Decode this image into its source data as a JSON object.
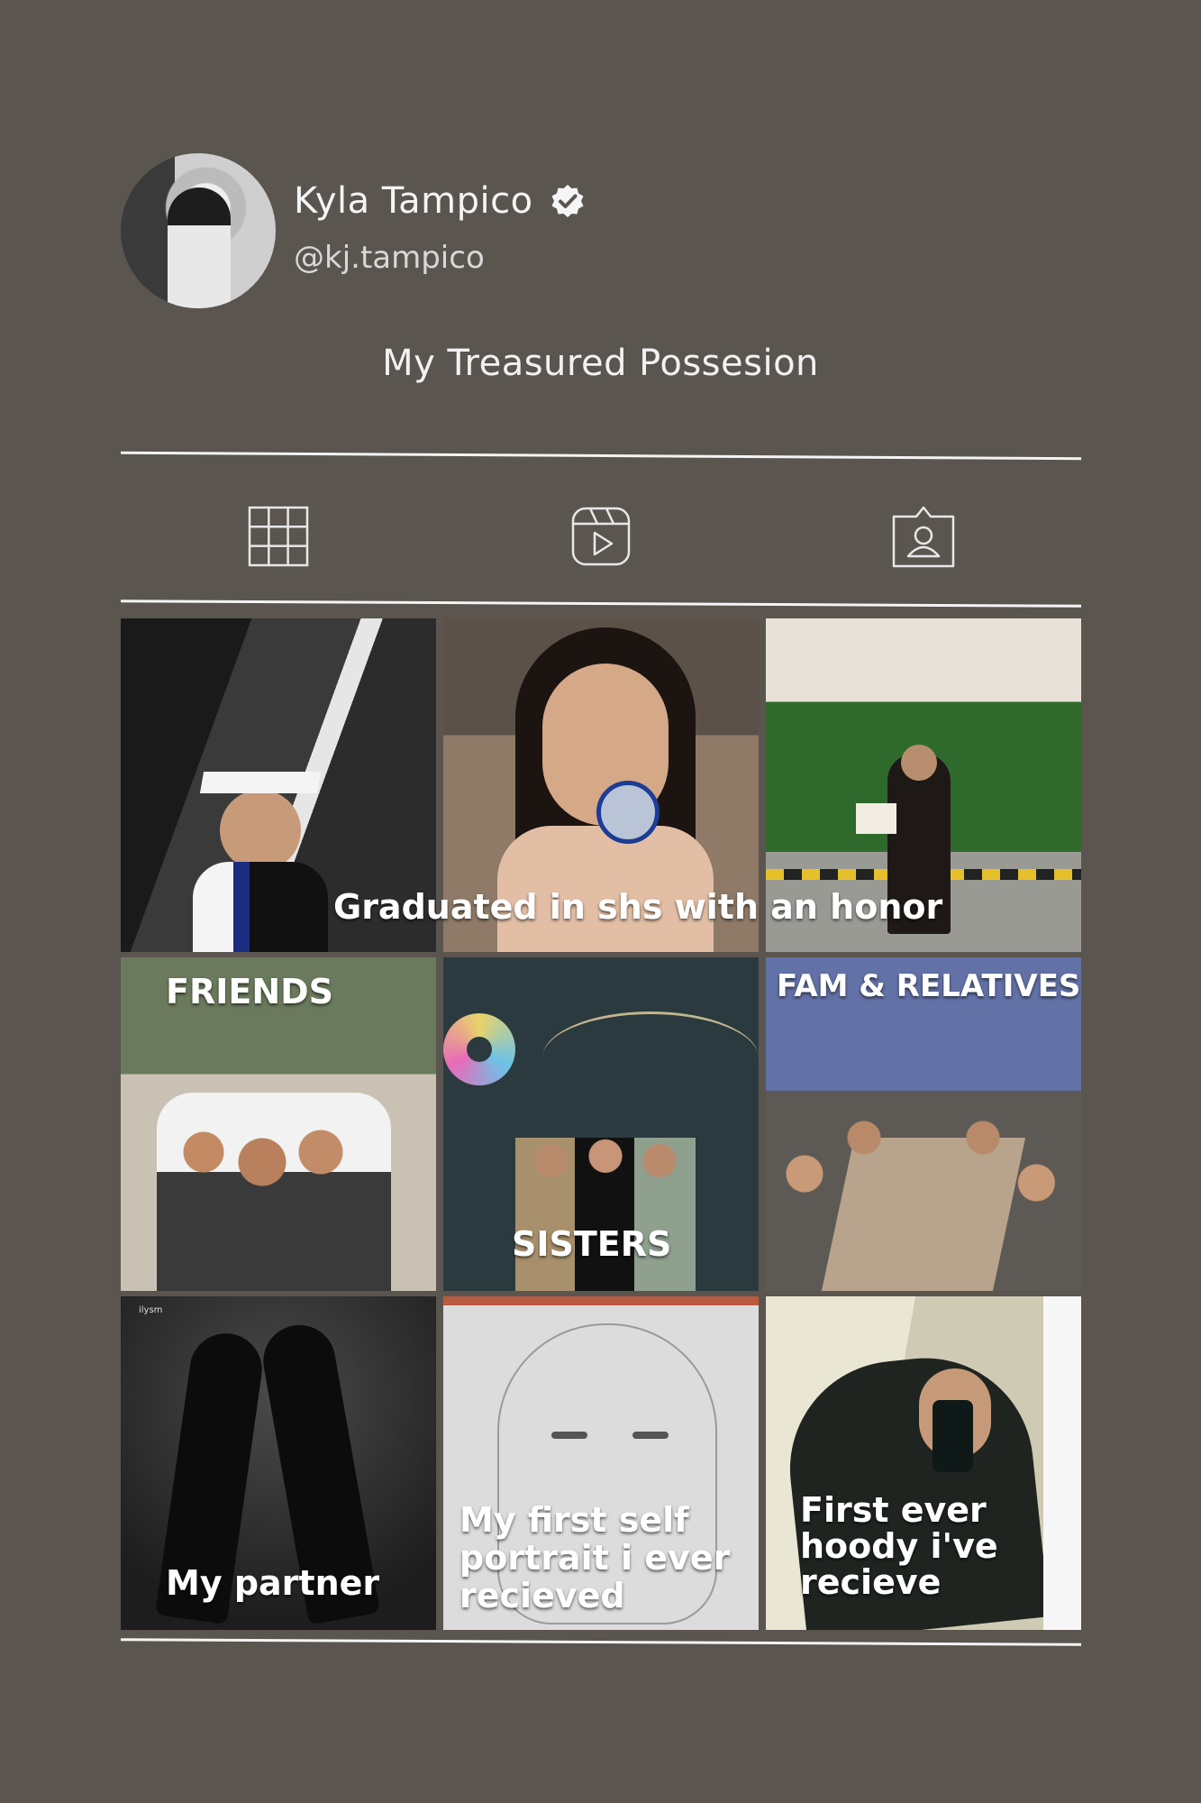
{
  "profile": {
    "name": "Kyla Tampico",
    "handle": "@kj.tampico",
    "bio": "My Treasured Possesion"
  },
  "tabs": [
    {
      "name": "grid-icon"
    },
    {
      "name": "reels-icon"
    },
    {
      "name": "tagged-icon"
    }
  ],
  "posts": [
    {
      "label": "",
      "scene": "graduation-studio"
    },
    {
      "label": "",
      "scene": "medal-selfie"
    },
    {
      "label": "",
      "scene": "graduation-garden"
    },
    {
      "label": "FRIENDS",
      "scene": "friends-selfie"
    },
    {
      "label": "SISTERS",
      "scene": "art-wall"
    },
    {
      "label": "FAM & RELATIVES",
      "scene": "family-dinner"
    },
    {
      "label": "My partner",
      "scene": "shadows"
    },
    {
      "label": "My first self portrait i ever recieved",
      "scene": "sketch"
    },
    {
      "label": "First ever hoody i've recieve",
      "scene": "mirror-selfie"
    }
  ],
  "row_caption": "Graduated in shs with an honor",
  "corner_text": "ilysm"
}
